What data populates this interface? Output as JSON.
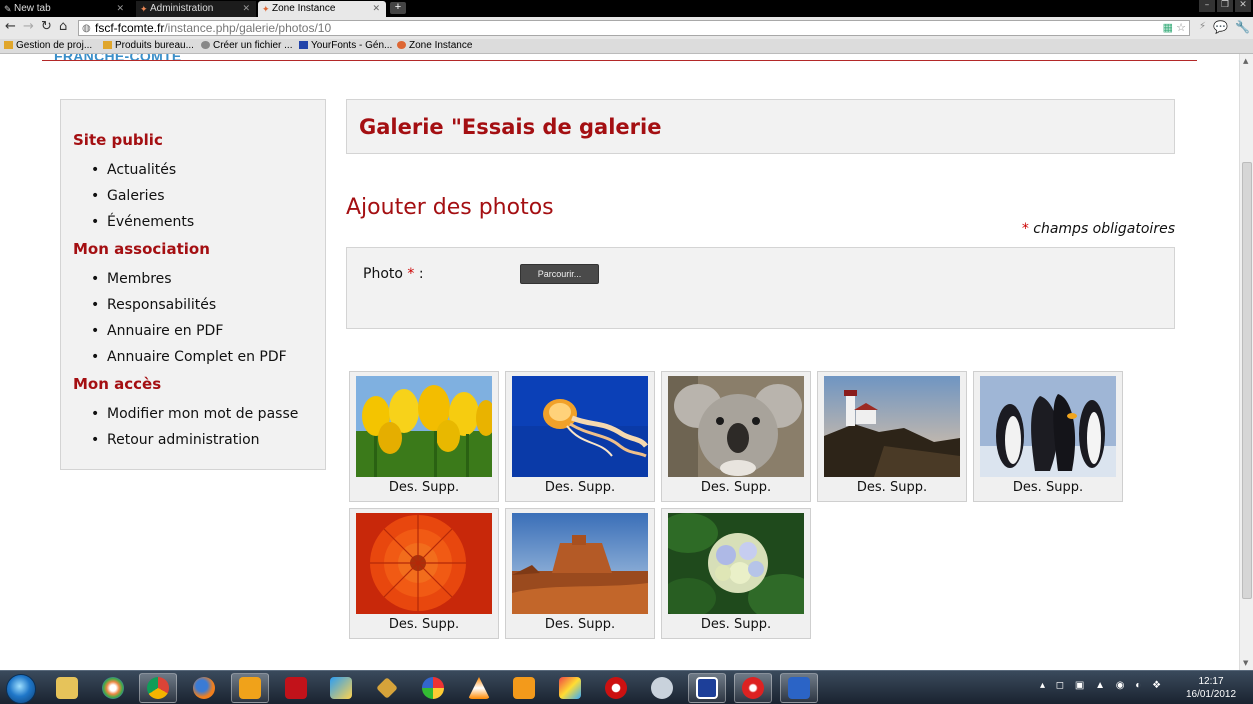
{
  "browser": {
    "tabs": [
      {
        "label": "New tab"
      },
      {
        "label": "Administration"
      },
      {
        "label": "Zone Instance"
      }
    ],
    "new_tab_symbol": "+",
    "url_host": "fscf-fcomte.fr",
    "url_path": "/instance.php/galerie/photos/10",
    "bookmarks": [
      {
        "label": "Gestion de proj...",
        "icon": "folder-icon"
      },
      {
        "label": "Produits bureau...",
        "icon": "folder-icon"
      },
      {
        "label": "Créer un fichier ...",
        "icon": "page-icon"
      },
      {
        "label": "YourFonts - Gén...",
        "icon": "yourfonts-icon"
      },
      {
        "label": "Zone Instance",
        "icon": "zone-icon"
      }
    ]
  },
  "header": {
    "logo_text": "FRANCHE-COMTE"
  },
  "sidebar": {
    "sections": [
      {
        "title": "Site public",
        "items": [
          "Actualités",
          "Galeries",
          "Événements"
        ]
      },
      {
        "title": "Mon association",
        "items": [
          "Membres",
          "Responsabilités",
          "Annuaire en PDF",
          "Annuaire Complet en PDF"
        ]
      },
      {
        "title": "Mon accès",
        "items": [
          "Modifier mon mot de passe",
          "Retour administration"
        ]
      }
    ]
  },
  "main": {
    "gallery_title": "Galerie \"Essais de galerie",
    "add_photos_heading": "Ajouter des photos",
    "required_star": "*",
    "required_note": "champs obligatoires",
    "photo_label": "Photo",
    "photo_label_colon": ":",
    "browse_button": "Parcourir...",
    "thumbnails": [
      {
        "subject": "yellow tulips",
        "des": "Des.",
        "supp": "Supp."
      },
      {
        "subject": "jellyfish",
        "des": "Des.",
        "supp": "Supp."
      },
      {
        "subject": "koala",
        "des": "Des.",
        "supp": "Supp."
      },
      {
        "subject": "lighthouse",
        "des": "Des.",
        "supp": "Supp."
      },
      {
        "subject": "penguins",
        "des": "Des.",
        "supp": "Supp."
      },
      {
        "subject": "chrysanthemum",
        "des": "Des.",
        "supp": "Supp."
      },
      {
        "subject": "desert",
        "des": "Des.",
        "supp": "Supp."
      },
      {
        "subject": "hydrangeas",
        "des": "Des.",
        "supp": "Supp."
      }
    ]
  },
  "taskbar": {
    "clock_time": "12:17",
    "clock_date": "16/01/2012"
  },
  "colors": {
    "accent_red": "#a40f12",
    "panel_bg": "#f2f2f2",
    "logo_blue": "#3a8fc9"
  }
}
